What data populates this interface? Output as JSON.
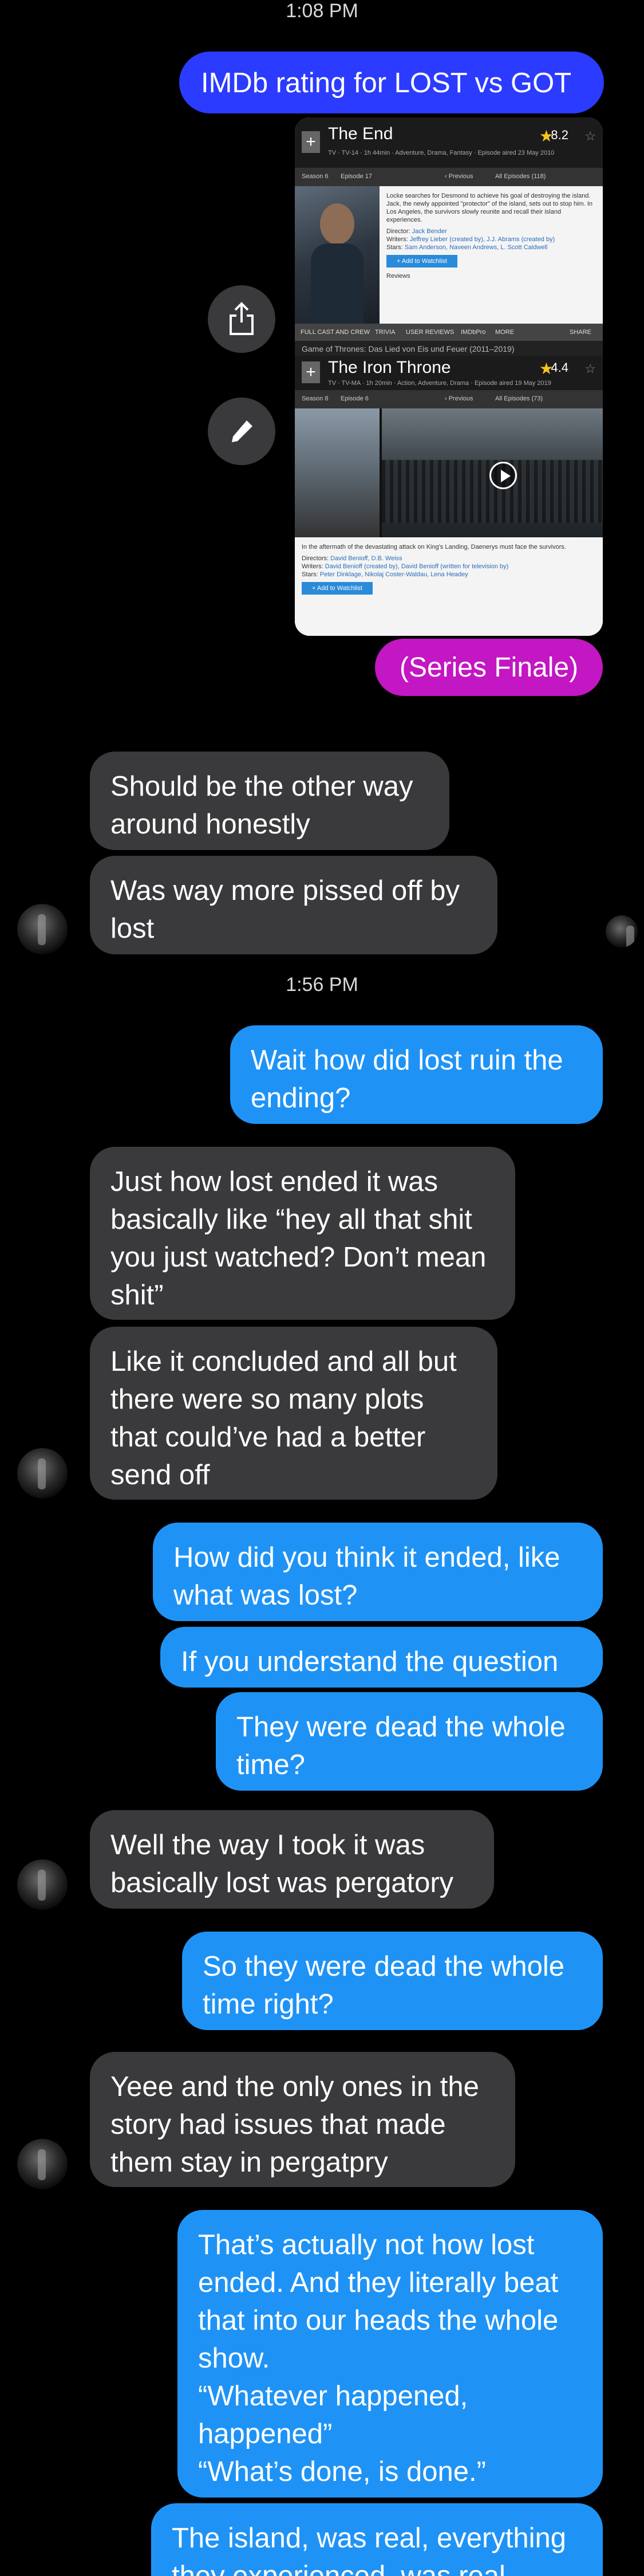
{
  "timestamps": [
    "1:08 PM",
    "1:56 PM"
  ],
  "screenshot": {
    "top": {
      "title": "The End",
      "meta": "TV · TV-14 · 1h 44min · Adventure, Drama, Fantasy · Episode aired 23 May 2010",
      "rating": "8.2",
      "rate_label": "Rate This",
      "season": "Season 6",
      "episode": "Episode 17",
      "prev": "‹ Previous",
      "all_eps": "All Episodes (118)",
      "plot": "Locke searches for Desmond to achieve his goal of destroying the island. Jack, the newly appointed \"protector\" of the island, sets out to stop him. In Los Angeles, the survivors slowly reunite and recall their island experiences.",
      "director_label": "Director:",
      "director": "Jack Bender",
      "writers_label": "Writers:",
      "writers": "Jeffrey Lieber (created by), J.J. Abrams (created by)",
      "stars_label": "Stars:",
      "stars": "Sam Anderson, Naveen Andrews, L. Scott Caldwell",
      "watch": "+ Add to Watchlist",
      "reviews": "Reviews"
    },
    "tabs": [
      "FULL CAST AND CREW",
      "TRIVIA",
      "USER REVIEWS",
      "IMDbPro",
      "MORE",
      "SHARE"
    ],
    "series2": "Game of Thrones: Das Lied von Eis und Feuer (2011–2019)",
    "bottom": {
      "title": "The Iron Throne",
      "meta": "TV · TV-MA · 1h 20min · Action, Adventure, Drama · Episode aired 19 May 2019",
      "rating": "4.4",
      "rate_label": "Rate This",
      "season": "Season 8",
      "episode": "Episode 6",
      "prev": "‹ Previous",
      "all_eps": "All Episodes (73)",
      "plot": "In the aftermath of the devastating attack on King's Landing, Daenerys must face the survivors.",
      "directors_label": "Directors:",
      "directors": "David Benioff, D.B. Weiss",
      "writers_label": "Writers:",
      "writers": "David Benioff (created by), David Benioff (written for television by)",
      "stars_label": "Stars:",
      "stars": "Peter Dinklage, Nikolaj Coster-Waldau, Lena Headey",
      "watch": "+ Add to Watchlist"
    }
  },
  "messages": {
    "m1": "IMDb rating for LOST vs GOT",
    "m2": "(Series Finale)",
    "m3": "Should be the other way around honestly",
    "m4": "Was way more pissed off by lost",
    "m5": "Wait how did lost ruin the ending?",
    "m6": "Just how lost ended it was basically like “hey all that shit you just watched? Don’t mean shit”",
    "m7": "Like it concluded and all but there were so many plots that could’ve had a better send off",
    "m8": "How did you think it ended, like what was lost?",
    "m9": "If you understand the question",
    "m10": "They were dead the whole time?",
    "m11": "Well the way I took it was basically lost was pergatory",
    "m12": "So they were dead the whole time right?",
    "m13": "Yeee and the only ones in the story had issues that made them stay in pergatpry",
    "m14": "That’s actually not how lost ended. And they literally beat that into our heads the whole show.\n“Whatever happened, happened”\n“What’s done, is done.”",
    "m15": "The island, was real, everything they experienced, was real"
  },
  "icons": {
    "share": "share-icon",
    "markup": "pen-icon"
  },
  "colors": {
    "outgoing": "#1f93f5",
    "outgoing_first": "#2b3bff",
    "incoming": "#3a3a3c",
    "highlight": "#c217c2"
  }
}
